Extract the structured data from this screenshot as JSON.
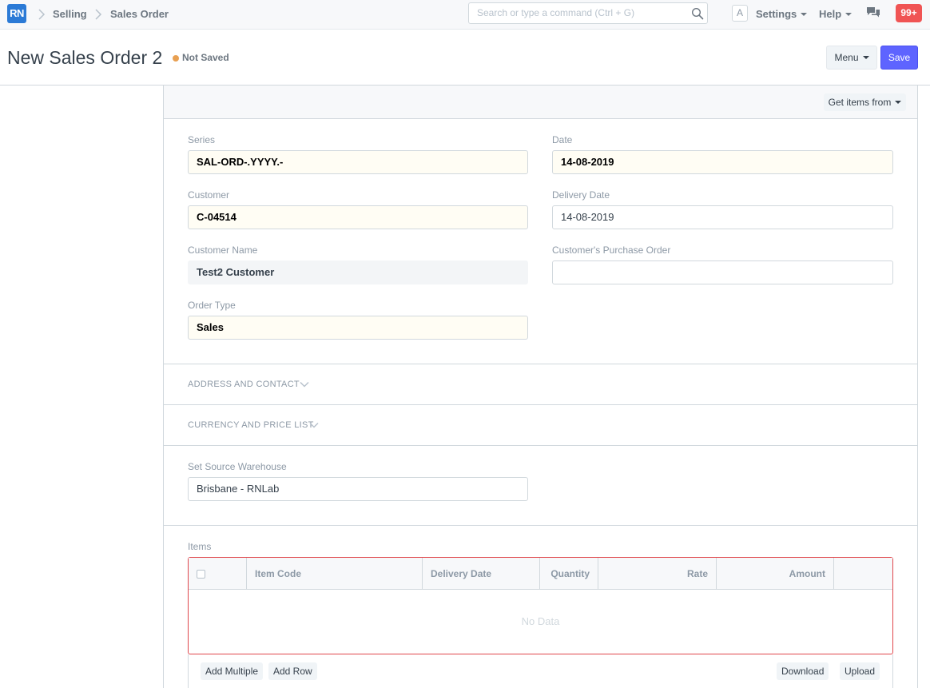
{
  "navbar": {
    "logo": "RN",
    "breadcrumbs": [
      "Selling",
      "Sales Order"
    ],
    "search_placeholder": "Search or type a command (Ctrl + G)",
    "avatar_letter": "A",
    "settings_label": "Settings",
    "help_label": "Help",
    "notification_count": "99+"
  },
  "page": {
    "title": "New Sales Order 2",
    "status": "Not Saved",
    "menu_label": "Menu",
    "save_label": "Save"
  },
  "toolbar": {
    "get_items_label": "Get items from"
  },
  "form": {
    "series": {
      "label": "Series",
      "value": "SAL-ORD-.YYYY.-"
    },
    "date": {
      "label": "Date",
      "value": "14-08-2019"
    },
    "customer": {
      "label": "Customer",
      "value": "C-04514"
    },
    "delivery_date": {
      "label": "Delivery Date",
      "value": "14-08-2019"
    },
    "customer_name": {
      "label": "Customer Name",
      "value": "Test2 Customer"
    },
    "customer_po": {
      "label": "Customer's Purchase Order",
      "value": ""
    },
    "order_type": {
      "label": "Order Type",
      "value": "Sales"
    },
    "section_address": "ADDRESS AND CONTACT",
    "section_currency": "CURRENCY AND PRICE LIST",
    "source_warehouse": {
      "label": "Set Source Warehouse",
      "value": "Brisbane - RNLab"
    }
  },
  "items": {
    "label": "Items",
    "columns": [
      "Item Code",
      "Delivery Date",
      "Quantity",
      "Rate",
      "Amount"
    ],
    "empty_text": "No Data",
    "add_multiple_label": "Add Multiple",
    "add_row_label": "Add Row",
    "download_label": "Download",
    "upload_label": "Upload"
  },
  "colors": {
    "primary": "#5e64ff",
    "logo": "#2b7ad6",
    "status_dot": "#e8a052",
    "notification": "#f05454",
    "grid_error_border": "#e0474c"
  }
}
